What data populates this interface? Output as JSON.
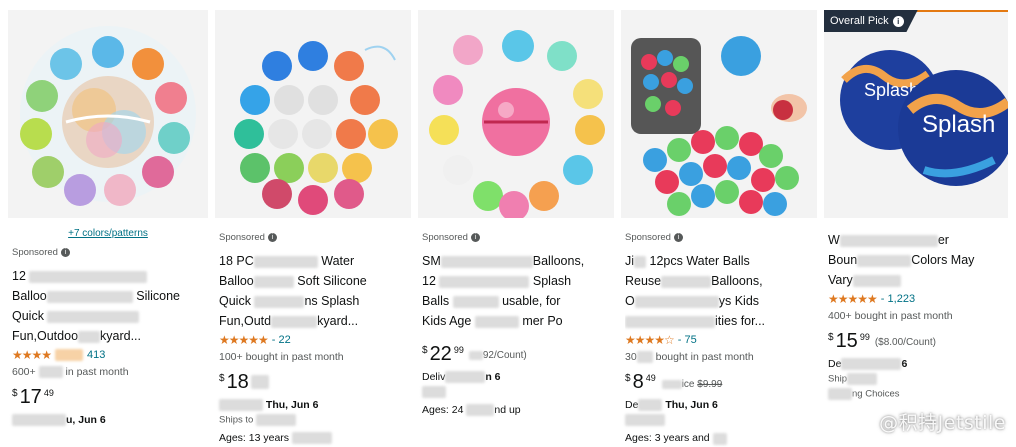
{
  "products": [
    {
      "colors_link": "+7 colors/patterns",
      "sponsored": "Sponsored",
      "title_lines": [
        "12",
        "Balloo",
        "Quick",
        "Fun,Outdoo"
      ],
      "title_tails": [
        "",
        "Silicone",
        "",
        "kyard..."
      ],
      "rating_count": "413",
      "bought": "600+",
      "bought_tail": "in past month",
      "price_whole": "17",
      "price_frac": "49",
      "delivery_tail": "u, Jun 6"
    },
    {
      "sponsored": "Sponsored",
      "title_lines": [
        "18 PC",
        "Balloo",
        "Quick",
        "Fun,Outd"
      ],
      "title_tails": [
        "Water",
        "Soft Silicone",
        "ns Splash",
        "kyard..."
      ],
      "rating_count": "22",
      "bought": "100+ bought in past month",
      "price_whole": "18",
      "delivery_tail": "Thu, Jun 6",
      "ships": "Ships to",
      "ages": "Ages: 13 years"
    },
    {
      "sponsored": "Sponsored",
      "title_lines": [
        "SM",
        "12",
        "Balls",
        "Kids Age"
      ],
      "title_tails": [
        "Balloons,",
        "Splash",
        "usable, for",
        "mer Po"
      ],
      "price_whole": "22",
      "price_frac": "99",
      "unit": "92/Count)",
      "delivery_head": "Deliv",
      "delivery_tail": "n 6",
      "ages_head": "Ages: 24",
      "ages_tail": "nd up"
    },
    {
      "sponsored": "Sponsored",
      "title_lines": [
        "Ji",
        "Reuse",
        "O",
        ""
      ],
      "title_tails": [
        "12pcs Water Balls",
        "Balloons,",
        "ys Kids",
        "ities for..."
      ],
      "rating_count": "75",
      "bought_head": "30",
      "bought_tail": "bought in past month",
      "price_whole": "8",
      "price_frac": "49",
      "list_price_label": "ice",
      "list_price": "$9.99",
      "delivery_head": "De",
      "delivery_tail": "Thu, Jun 6",
      "ages": "Ages: 3 years and"
    },
    {
      "badge": "Overall Pick",
      "title_lines": [
        "W",
        "Boun",
        "Vary"
      ],
      "title_tails": [
        "er",
        "Colors May",
        ""
      ],
      "rating_count": "1,223",
      "bought": "400+ bought in past month",
      "price_whole": "15",
      "price_frac": "99",
      "unit": "($8.00/Count)",
      "delivery_head": "De",
      "delivery_tail": "6",
      "ships_head": "Ship",
      "choices": "ng Choices",
      "ball_text": "Splash"
    }
  ],
  "watermark": "@积持Jetstile",
  "colors": {
    "link": "#007185",
    "star": "#de7921",
    "badge": "#232f3e",
    "text": "#0f1111",
    "muted": "#565959"
  }
}
